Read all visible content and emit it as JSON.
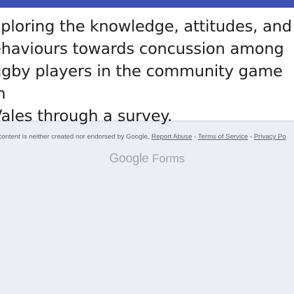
{
  "form": {
    "title": "Exploring the knowledge, attitudes, and behaviours towards concussion among rugby players in the community game in Wales through a survey.",
    "title_lines": [
      "xploring the knowledge, attitudes, and",
      "ehaviours towards concussion among",
      "ugby players in the community game in",
      "Vales through a survey."
    ],
    "accent_color": "#3f51b5"
  },
  "footer": {
    "disclaimer": "is content is neither created nor endorsed by Google.",
    "report_abuse": "Report Abuse",
    "sep1": " - ",
    "terms": "Terms of Service",
    "sep2": " - ",
    "privacy": "Privacy Po"
  },
  "branding": {
    "google": "Google",
    "forms": "Forms"
  }
}
